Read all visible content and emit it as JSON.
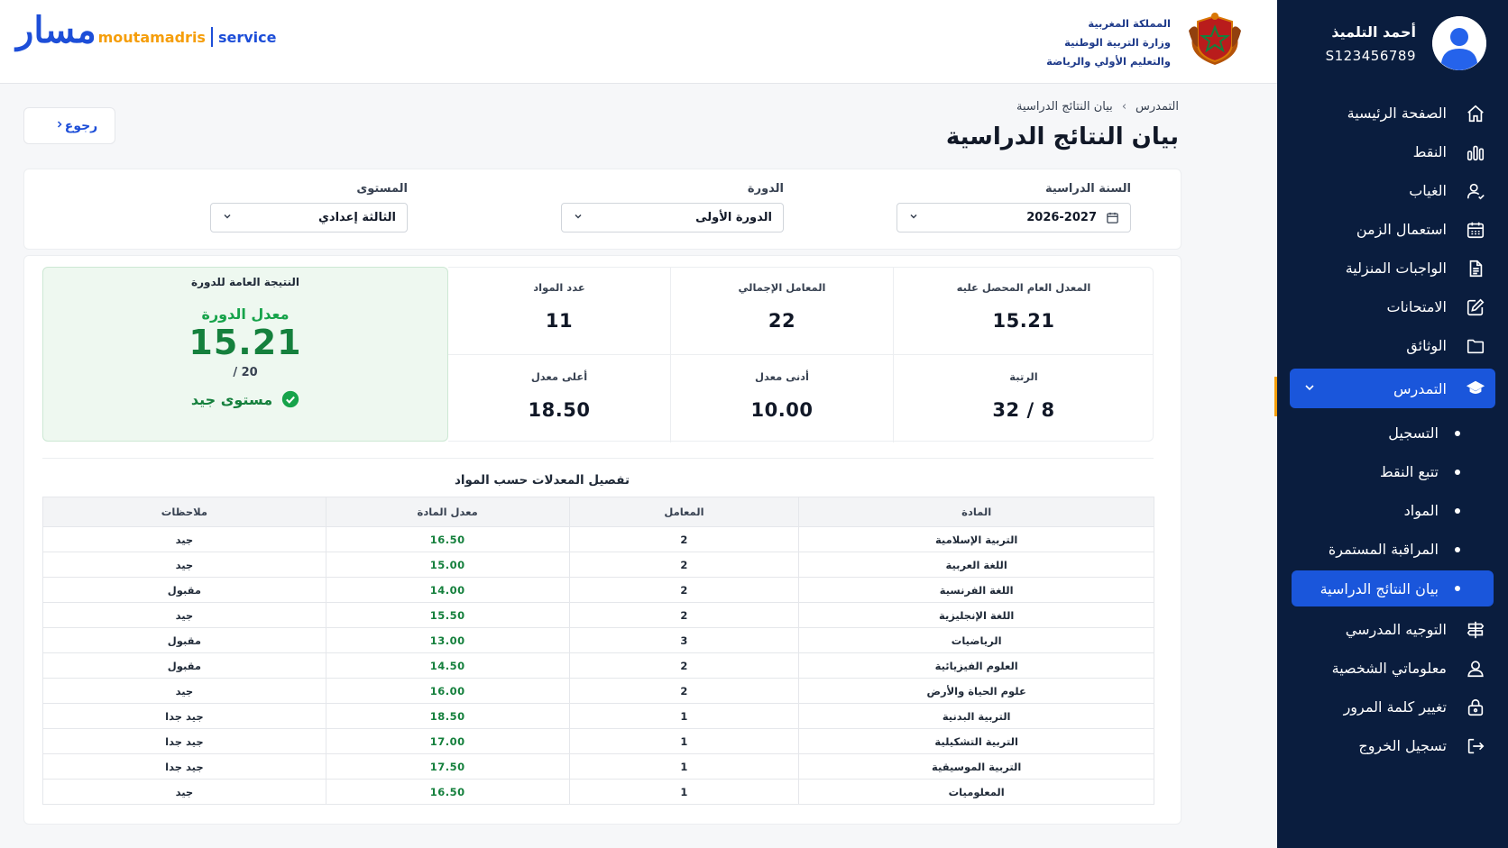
{
  "header": {
    "logo": {
      "arabic": "مسار",
      "brand": "moutamadris",
      "service": "service"
    },
    "ministry": [
      "المملكة المغربية",
      "وزارة التربية الوطنية",
      "والتعليم الأولي والرياضة"
    ]
  },
  "profile": {
    "name": "أحمد التلميذ",
    "id": "S123456789"
  },
  "sidebar": {
    "items": [
      {
        "label": "الصفحة الرئيسية",
        "icon": "home-icon"
      },
      {
        "label": "النقط",
        "icon": "bar-chart-icon"
      },
      {
        "label": "الغياب",
        "icon": "user-absence-icon"
      },
      {
        "label": "استعمال الزمن",
        "icon": "calendar-icon"
      },
      {
        "label": "الواجبات المنزلية",
        "icon": "document-icon"
      },
      {
        "label": "الامتحانات",
        "icon": "edit-icon"
      },
      {
        "label": "الوثائق",
        "icon": "folder-icon"
      }
    ],
    "parent": {
      "label": "التمدرس",
      "icon": "graduation-cap-icon"
    },
    "sub_items": [
      "التسجيل",
      "تتبع النقط",
      "المواد",
      "المراقبة المستمرة",
      "بيان النتائج الدراسية"
    ],
    "bottom_items": [
      {
        "label": "التوجيه المدرسي",
        "icon": "signpost-icon"
      },
      {
        "label": "معلوماتي الشخصية",
        "icon": "person-icon"
      },
      {
        "label": "تغيير كلمة المرور",
        "icon": "lock-icon"
      },
      {
        "label": "تسجيل الخروج",
        "icon": "logout-icon"
      }
    ]
  },
  "main": {
    "back_label": "رجوع",
    "breadcrumb": [
      "التمدرس",
      "بيان النتائج الدراسية"
    ],
    "title": "بيان النتائج الدراسية",
    "filters": {
      "year": {
        "label": "السنة الدراسية",
        "value": "2026-2027"
      },
      "session": {
        "label": "الدورة",
        "value": "الدورة الأولى"
      },
      "level": {
        "label": "المستوى",
        "value": "الثالثة إعدادي"
      }
    },
    "overall": {
      "header": "النتيجة العامة للدورة",
      "subtitle": "معدل الدورة",
      "value": "15.21",
      "out_of": "/ 20",
      "level": "مستوى جيد"
    },
    "stats": [
      {
        "label": "المعدل العام المحصل عليه",
        "value": "15.21"
      },
      {
        "label": "المعامل الإجمالي",
        "value": "22"
      },
      {
        "label": "عدد المواد",
        "value": "11"
      },
      {
        "label": "الرتبة",
        "value": "8 / 32"
      },
      {
        "label": "أدنى معدل",
        "value": "10.00"
      },
      {
        "label": "أعلى معدل",
        "value": "18.50"
      }
    ],
    "table": {
      "title": "تفصيل المعدلات حسب المواد",
      "headers": [
        "المادة",
        "المعامل",
        "معدل المادة",
        "ملاحظات"
      ],
      "rows": [
        [
          "التربية الإسلامية",
          "2",
          "16.50",
          "جيد"
        ],
        [
          "اللغة العربية",
          "2",
          "15.00",
          "جيد"
        ],
        [
          "اللغة الفرنسية",
          "2",
          "14.00",
          "مقبول"
        ],
        [
          "اللغة الإنجليزية",
          "2",
          "15.50",
          "جيد"
        ],
        [
          "الرياضيات",
          "3",
          "13.00",
          "مقبول"
        ],
        [
          "العلوم الفيزيائية",
          "2",
          "14.50",
          "مقبول"
        ],
        [
          "علوم الحياة والأرض",
          "2",
          "16.00",
          "جيد"
        ],
        [
          "التربية البدنية",
          "1",
          "18.50",
          "جيد جدا"
        ],
        [
          "التربية التشكيلية",
          "1",
          "17.00",
          "جيد جدا"
        ],
        [
          "التربية الموسيقية",
          "1",
          "17.50",
          "جيد جدا"
        ],
        [
          "المعلوميات",
          "1",
          "16.50",
          "جيد"
        ]
      ]
    }
  },
  "colors": {
    "sidebar_bg": "#0a1d3e",
    "accent_blue": "#1a56db",
    "success_green": "#15803d",
    "brand_orange": "#f59e0b"
  }
}
